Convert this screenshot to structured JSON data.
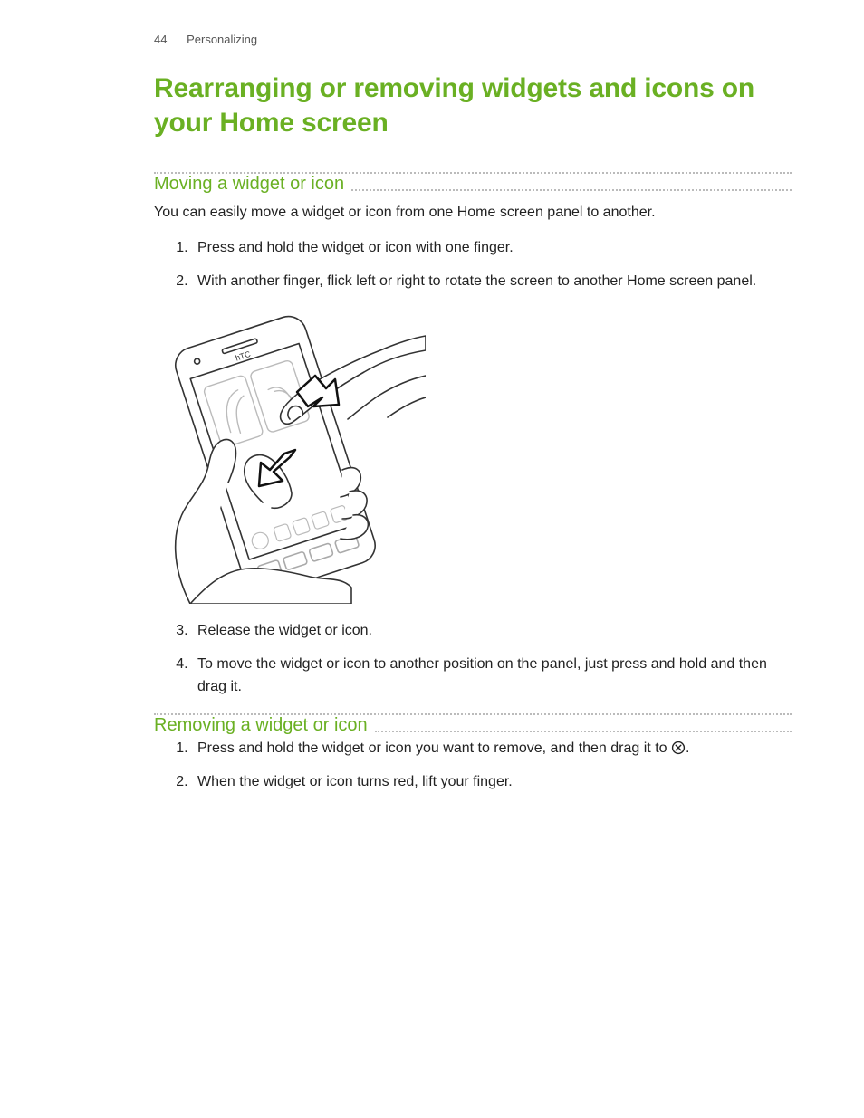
{
  "header": {
    "page_number": "44",
    "section": "Personalizing"
  },
  "title": "Rearranging or removing widgets and icons on your Home screen",
  "sections": {
    "moving": {
      "heading": "Moving a widget or icon",
      "intro": "You can easily move a widget or icon from one Home screen panel to another.",
      "step1": "Press and hold the widget or icon with one finger.",
      "step2": "With another finger, flick left or right to rotate the screen to another Home screen panel.",
      "step3": "Release the widget or icon.",
      "step4": "To move the widget or icon to another position on the panel, just press and hold and then drag it."
    },
    "removing": {
      "heading": "Removing a widget or icon",
      "step1_prefix": "Press and hold the widget or icon you want to remove, and then drag it to ",
      "step1_suffix": ".",
      "step2": "When the widget or icon turns red, lift your finger."
    }
  },
  "icons": {
    "remove": "remove-circle-icon"
  }
}
